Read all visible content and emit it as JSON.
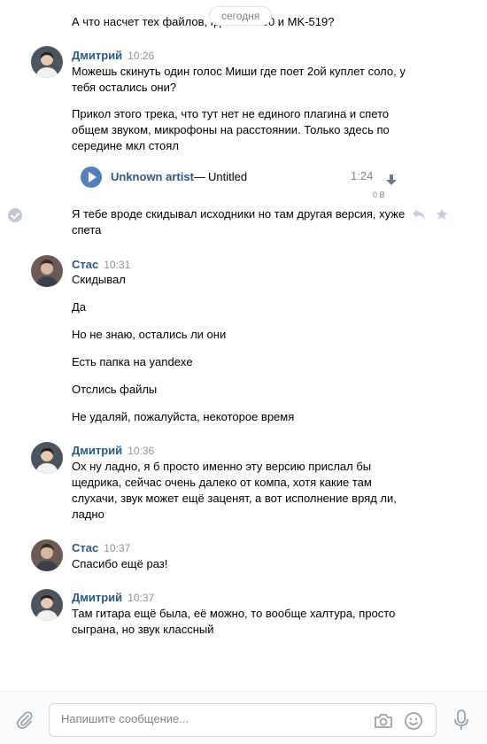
{
  "date_divider": "сегодня",
  "top_message": "А что насчет тех файлов, где MKE600 и MK-519?",
  "groups": [
    {
      "author": "Дмитрий",
      "time": "10:26",
      "messages": [
        "Можешь скинуть один голос Миши где поет 2ой куплет соло, у тебя остались они?",
        "Прикол этого трека, что тут нет не единого плагина и спето общем звуком, микрофоны на расстоянии. Только здесь по середине мкл стоял"
      ],
      "audio": {
        "artist": "Unknown artist",
        "separator": "—",
        "title": "Untitled",
        "duration": "1:24",
        "size": "0 B"
      },
      "extra_message": "Я тебе вроде скидывал исходники но там другая версия, хуже спета"
    },
    {
      "author": "Стас",
      "time": "10:31",
      "messages": [
        "Скидывал",
        "Да",
        "Но не знаю, остались ли они",
        "Есть папка на yandexe",
        "Отслись файлы",
        "Не удаляй, пожалуйста, некоторое время"
      ]
    },
    {
      "author": "Дмитрий",
      "time": "10:36",
      "messages": [
        "Ох ну ладно, я б просто именно эту версию прислал бы щедрика, сейчас очень далеко от компа, хотя какие там слухачи, звук может ещё заценят, а вот исполнение вряд ли, ладно"
      ]
    },
    {
      "author": "Стас",
      "time": "10:37",
      "messages": [
        "Спасибо ещё раз!"
      ]
    },
    {
      "author": "Дмитрий",
      "time": "10:37",
      "messages": [
        "Там гитара ещё была, её можно, то вообще халтура, просто сыграна, но звук классный"
      ]
    }
  ],
  "composer": {
    "placeholder": "Напишите сообщение..."
  },
  "colors": {
    "accent": "#5181b8",
    "author_link": "#2a5885",
    "meta_gray": "#939393"
  },
  "icons": {
    "attach": "paperclip-icon",
    "camera": "camera-icon",
    "smile": "smile-icon",
    "mic": "microphone-icon",
    "play": "play-icon",
    "download": "download-icon",
    "reply": "reply-icon",
    "star": "star-icon",
    "read": "check-icon"
  }
}
